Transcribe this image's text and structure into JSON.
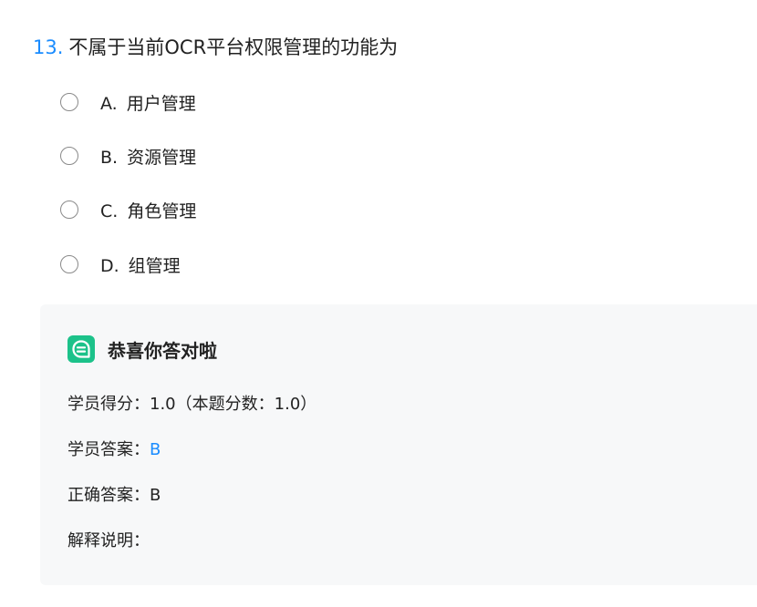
{
  "question": {
    "number": "13.",
    "text": "不属于当前OCR平台权限管理的功能为"
  },
  "options": [
    {
      "key": "A.",
      "label": "用户管理"
    },
    {
      "key": "B.",
      "label": "资源管理"
    },
    {
      "key": "C.",
      "label": "角色管理"
    },
    {
      "key": "D.",
      "label": "组管理"
    }
  ],
  "result": {
    "icon": "chat-bubble-icon",
    "title": "恭喜你答对啦",
    "score_label": "学员得分：",
    "score_value": "1.0",
    "full_score_text": "（本题分数：1.0）",
    "student_answer_label": "学员答案：",
    "student_answer_value": "B",
    "correct_answer_label": "正确答案：",
    "correct_answer_value": "B",
    "explanation_label": "解释说明："
  },
  "colors": {
    "accent": "#1a8cff",
    "success": "#1cc28a",
    "panel_background": "#f7f8f9",
    "text": "#222222"
  }
}
